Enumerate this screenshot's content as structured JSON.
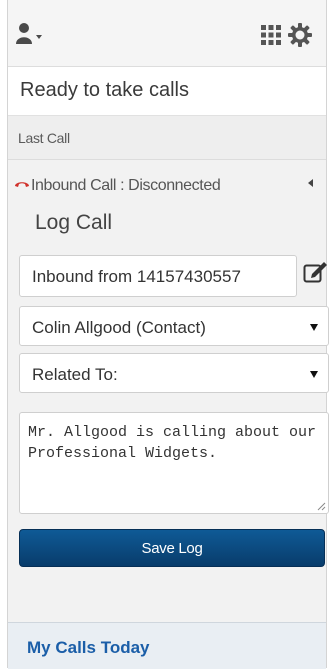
{
  "header": {
    "user_menu_icon": "user-dropdown-icon",
    "apps_icon": "grid-icon",
    "settings_icon": "gear-icon"
  },
  "status": {
    "text": "Ready to take calls"
  },
  "last_call": {
    "label": "Last Call"
  },
  "call": {
    "status_text": "Inbound Call : Disconnected",
    "icon": "phone-hangup-icon",
    "icon_color": "#d0322c"
  },
  "log_call": {
    "title": "Log Call",
    "subject_value": "Inbound from 14157430557",
    "contact_value": "Colin Allgood (Contact)",
    "related_value": "Related To:",
    "notes_value": "Mr. Allgood is calling about our Professional Widgets.",
    "save_label": "Save Log"
  },
  "footer": {
    "link_text": "My Calls Today"
  },
  "colors": {
    "accent": "#0b4a82",
    "link": "#1b5ea8"
  }
}
